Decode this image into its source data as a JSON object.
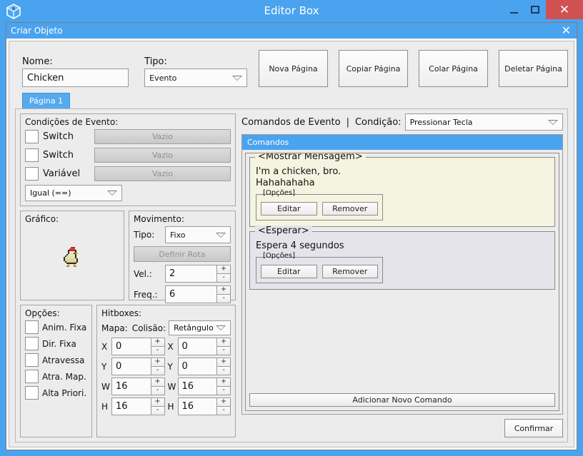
{
  "window": {
    "title": "Editor Box",
    "icon": "cube-icon",
    "minimize_label": "–",
    "maximize_label": "□",
    "close_label": "✕"
  },
  "dialog": {
    "title": "Criar Objeto",
    "close_label": "✕"
  },
  "form": {
    "name_label": "Nome:",
    "name_value": "Chicken",
    "name_placeholder": "Nome",
    "type_label": "Tipo:",
    "type_value": "Evento",
    "page_buttons": [
      "Nova Página",
      "Copiar Página",
      "Colar Página",
      "Deletar Página"
    ]
  },
  "tabs": [
    {
      "label": "Página 1",
      "active": true
    }
  ],
  "conditions": {
    "title": "Condições de Evento:",
    "rows": [
      {
        "label": "Switch",
        "checked": false,
        "value": "Vazio"
      },
      {
        "label": "Switch",
        "checked": false,
        "value": "Vazio"
      },
      {
        "label": "Variável",
        "checked": false,
        "value": "Vazio"
      }
    ],
    "operator_value": "Igual (==)"
  },
  "graphic": {
    "title": "Gráfico:",
    "sprite": "chicken-sprite"
  },
  "movement": {
    "title": "Movimento:",
    "type_label": "Tipo:",
    "type_value": "Fixo",
    "route_button": "Definir Rota",
    "speed_label": "Vel.:",
    "speed_value": "2",
    "freq_label": "Freq.:",
    "freq_value": "6",
    "plus": "+",
    "minus": "-"
  },
  "options": {
    "title": "Opções:",
    "items": [
      {
        "label": "Anim. Fixa",
        "checked": false
      },
      {
        "label": "Dir. Fixa",
        "checked": false
      },
      {
        "label": "Atravessa",
        "checked": false
      },
      {
        "label": "Atra. Map.",
        "checked": false
      },
      {
        "label": "Alta Priori.",
        "checked": false
      }
    ]
  },
  "hitboxes": {
    "title": "Hitboxes:",
    "map_label": "Mapa:",
    "collision_label": "Colisão:",
    "collision_value": "Retângulo",
    "plus": "+",
    "minus": "-",
    "map": [
      {
        "axis": "X",
        "value": "0"
      },
      {
        "axis": "Y",
        "value": "0"
      },
      {
        "axis": "W",
        "value": "16"
      },
      {
        "axis": "H",
        "value": "16"
      }
    ],
    "collision": [
      {
        "axis": "X",
        "value": "0"
      },
      {
        "axis": "Y",
        "value": "0"
      },
      {
        "axis": "W",
        "value": "16"
      },
      {
        "axis": "H",
        "value": "16"
      }
    ]
  },
  "commands_panel": {
    "heading": "Comandos de Evento",
    "separator": "|",
    "condition_label": "Condição:",
    "condition_value": "Pressionar Tecla",
    "banner": "Comandos",
    "add_button": "Adicionar Novo Comando",
    "options_legend": "[Opções]",
    "edit_label": "Editar",
    "remove_label": "Remover",
    "commands": [
      {
        "legend": "<Mostrar Mensagem>",
        "lines": [
          "I'm a chicken, bro.",
          "Hahahahaha"
        ],
        "style": "msg"
      },
      {
        "legend": "<Esperar>",
        "lines": [
          "Espera 4 segundos"
        ],
        "style": "wait"
      }
    ]
  },
  "footer": {
    "confirm_label": "Confirmar"
  },
  "colors": {
    "accent": "#4aa3ef",
    "close_red": "#cf5151",
    "panel_bg": "#ececec",
    "message_bg": "#f4f4e1",
    "wait_bg": "#e4e4ea"
  }
}
